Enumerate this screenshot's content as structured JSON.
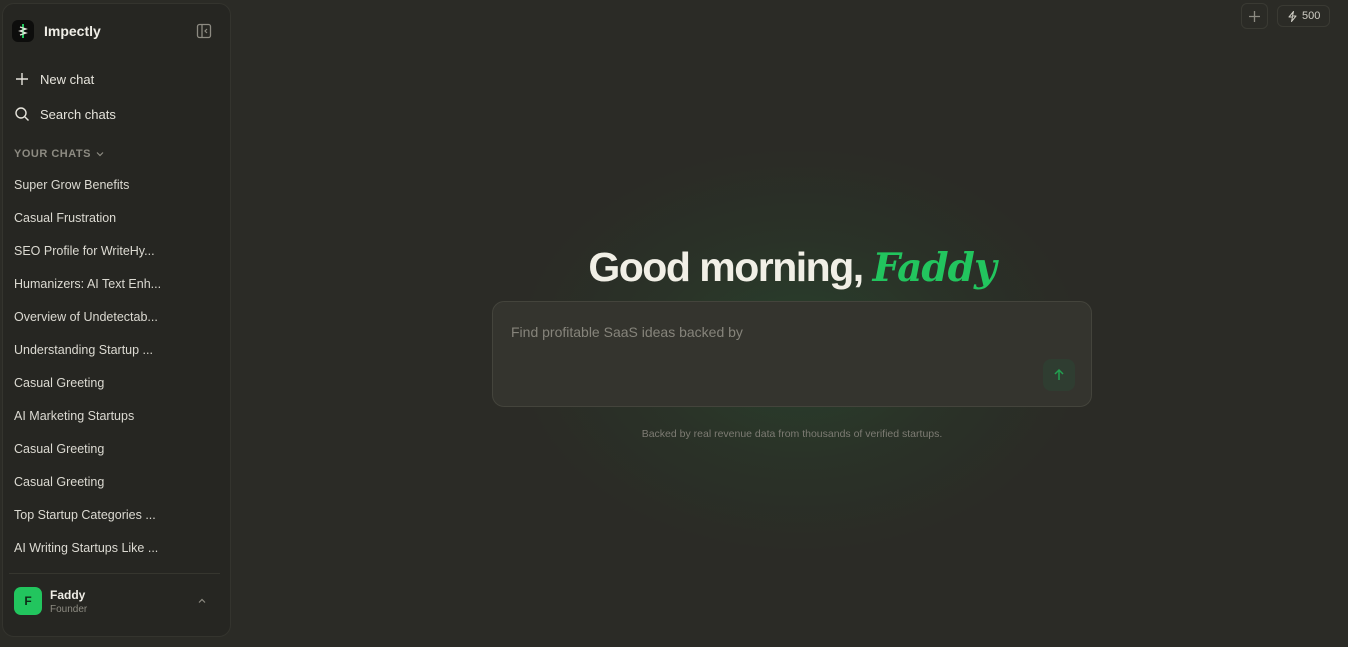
{
  "app": {
    "name": "Impectly"
  },
  "sidebar": {
    "new_chat_label": "New chat",
    "search_label": "Search chats",
    "section_title": "YOUR CHATS",
    "chats": [
      "Super Grow Benefits",
      "Casual Frustration",
      "SEO Profile for WriteHy...",
      "Humanizers: AI Text Enh...",
      "Overview of Undetectab...",
      "Understanding Startup ...",
      "Casual Greeting",
      "AI Marketing Startups",
      "Casual Greeting",
      "Casual Greeting",
      "Top Startup Categories ...",
      "AI Writing Startups Like ..."
    ]
  },
  "user": {
    "initial": "F",
    "name": "Faddy",
    "role": "Founder"
  },
  "topbar": {
    "credits": "500"
  },
  "main": {
    "greeting_prefix": "Good morning,",
    "greeting_name": "Faddy",
    "input_placeholder": "Find profitable SaaS ideas backed by",
    "caption": "Backed by real revenue data from thousands of verified startups."
  },
  "colors": {
    "accent": "#22c55e",
    "background": "#2b2b26",
    "sidebar": "#262622"
  }
}
